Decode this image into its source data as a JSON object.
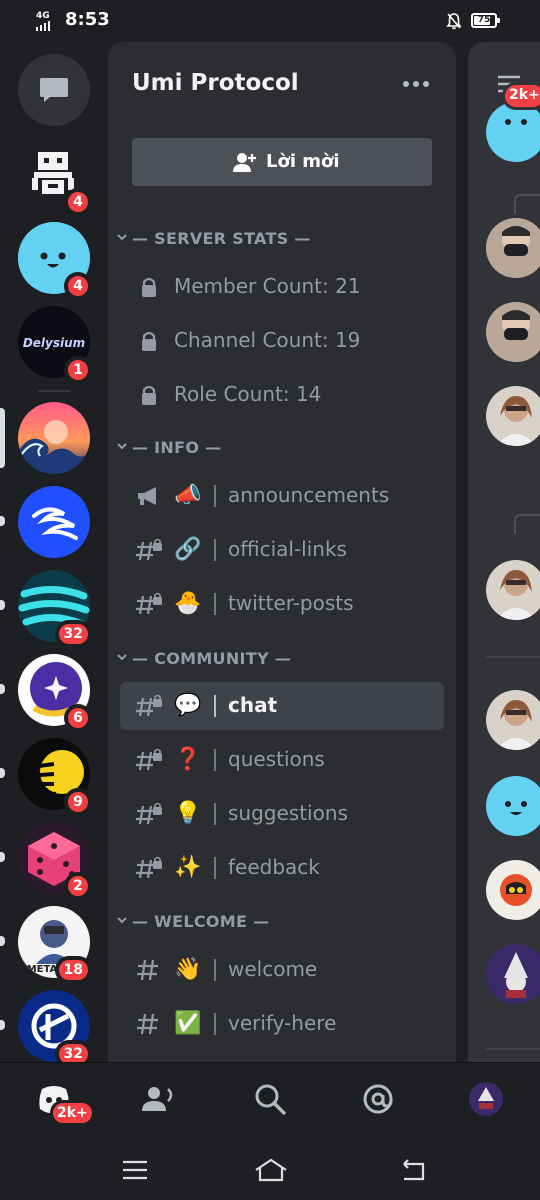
{
  "status_bar": {
    "network": "4G",
    "time": "8:53",
    "battery": "75"
  },
  "server_rail": {
    "servers": [
      {
        "name": "pixel-server",
        "badge": "4"
      },
      {
        "name": "smiley-server",
        "badge": "4"
      },
      {
        "name": "delysium-server",
        "badge": "1",
        "logo_text": "Delysium"
      },
      {
        "name": "wave-server",
        "badge": "",
        "selected": true
      },
      {
        "name": "blue-wave-server",
        "badge": ""
      },
      {
        "name": "teal-stripes-server",
        "badge": "32"
      },
      {
        "name": "space-cat-server",
        "badge": "6"
      },
      {
        "name": "sun-server",
        "badge": "9"
      },
      {
        "name": "dice-server",
        "badge": "2"
      },
      {
        "name": "meta-server",
        "badge": "18",
        "logo_text": "META"
      },
      {
        "name": "blue-logo-server",
        "badge": "32"
      }
    ]
  },
  "panel": {
    "server_title": "Umi Protocol",
    "invite_label": "Lời mời",
    "categories": [
      {
        "label": "— SERVER STATS —"
      },
      {
        "label": "— INFO —"
      },
      {
        "label": "— COMMUNITY —"
      },
      {
        "label": "— WELCOME —"
      }
    ],
    "stats": [
      "Member Count: 21",
      "Channel Count: 19",
      "Role Count: 14"
    ],
    "info_channels": [
      {
        "emoji": "📣",
        "name": "announcements"
      },
      {
        "emoji": "🔗",
        "name": "official-links"
      },
      {
        "emoji": "🐣",
        "name": "twitter-posts"
      }
    ],
    "community_channels": [
      {
        "emoji": "💬",
        "name": "chat",
        "active": true
      },
      {
        "emoji": "❓",
        "name": "questions"
      },
      {
        "emoji": "💡",
        "name": "suggestions"
      },
      {
        "emoji": "✨",
        "name": "feedback"
      }
    ],
    "welcome_channels": [
      {
        "emoji": "👋",
        "name": "welcome"
      },
      {
        "emoji": "✅",
        "name": "verify-here"
      }
    ]
  },
  "peek": {
    "badge": "2k+"
  },
  "tab_bar": {
    "home_badge": "2k+",
    "tabs": [
      "home-tab",
      "friends-tab",
      "search-tab",
      "mentions-tab",
      "profile-tab"
    ]
  },
  "colors": {
    "background": "#1e1f22",
    "panel": "#2b2d31",
    "badge": "#f23f43",
    "active_channel": "#404249"
  }
}
